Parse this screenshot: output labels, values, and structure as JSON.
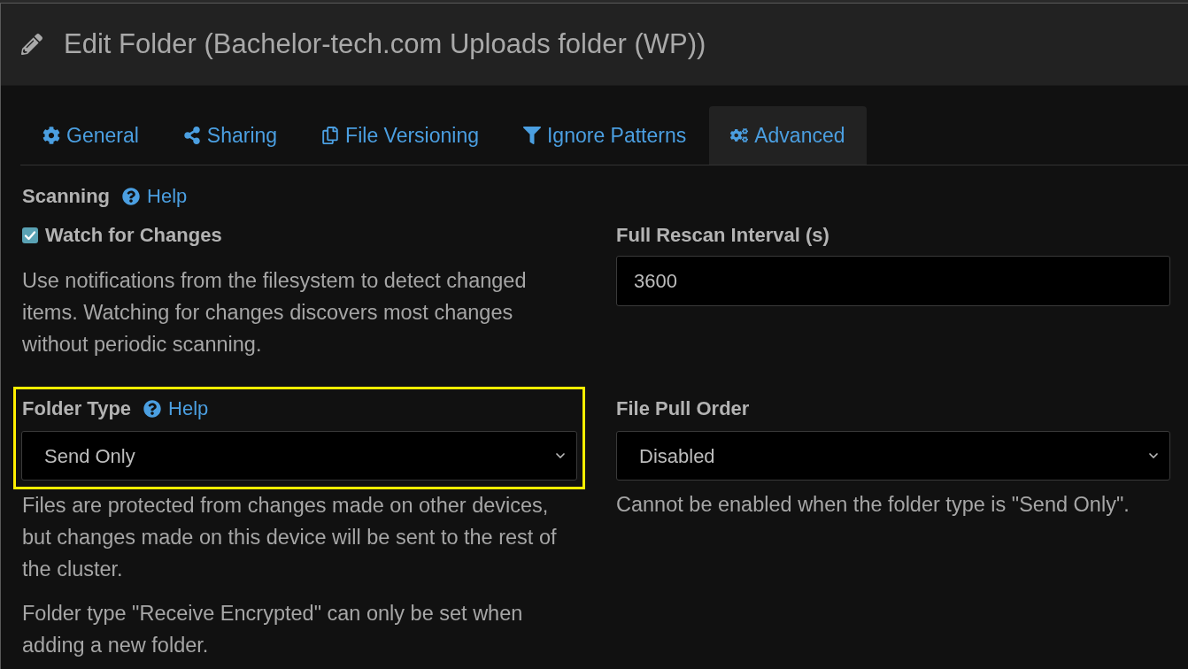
{
  "dialog": {
    "title": "Edit Folder (Bachelor-tech.com Uploads folder (WP))"
  },
  "tabs": [
    {
      "label": "General",
      "selected": false
    },
    {
      "label": "Sharing",
      "selected": false
    },
    {
      "label": "File Versioning",
      "selected": false
    },
    {
      "label": "Ignore Patterns",
      "selected": false
    },
    {
      "label": "Advanced",
      "selected": true
    }
  ],
  "scanning": {
    "heading": "Scanning",
    "help": "Help",
    "watch_for_changes": {
      "label": "Watch for Changes",
      "checked": true
    },
    "description": "Use notifications from the filesystem to detect changed items. Watching for changes discovers most changes without periodic scanning."
  },
  "full_rescan_interval": {
    "label": "Full Rescan Interval (s)",
    "value": "3600"
  },
  "folder_type": {
    "label": "Folder Type",
    "help": "Help",
    "value": "Send Only",
    "highlighted": true,
    "description": "Files are protected from changes made on other devices, but changes made on this device will be sent to the rest of the cluster.",
    "note": "Folder type \"Receive Encrypted\" can only be set when adding a new folder."
  },
  "file_pull_order": {
    "label": "File Pull Order",
    "value": "Disabled",
    "description": "Cannot be enabled when the folder type is \"Send Only\"."
  }
}
